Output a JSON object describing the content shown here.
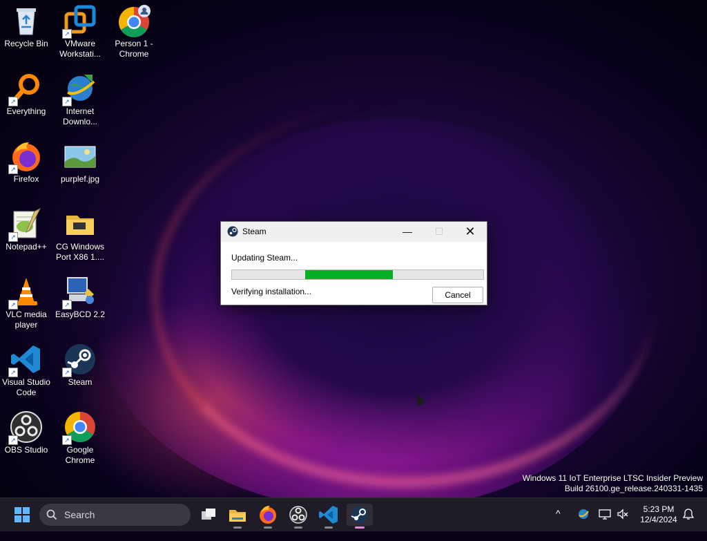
{
  "desktop": {
    "icons": [
      {
        "label": "Recycle Bin"
      },
      {
        "label": "VMware Workstati..."
      },
      {
        "label": "Person 1 - Chrome"
      },
      {
        "label": "Everything"
      },
      {
        "label": "Internet Downlo..."
      },
      {
        "label": "Firefox"
      },
      {
        "label": "purplef.jpg"
      },
      {
        "label": "Notepad++"
      },
      {
        "label": "CG Windows Port X86 1...."
      },
      {
        "label": "VLC media player"
      },
      {
        "label": "EasyBCD 2.2"
      },
      {
        "label": "Visual Studio Code"
      },
      {
        "label": "Steam"
      },
      {
        "label": "OBS Studio"
      },
      {
        "label": "Google Chrome"
      }
    ],
    "watermark": {
      "line1": "Windows 11 IoT Enterprise LTSC Insider Preview",
      "line2": "Build 26100.ge_release.240331-1435"
    }
  },
  "dialog": {
    "title": "Steam",
    "status": "Updating Steam...",
    "detail": "Verifying installation...",
    "cancel_label": "Cancel",
    "progress": 0.35,
    "minimize_glyph": "—",
    "maximize_glyph": "☐",
    "close_glyph": "✕"
  },
  "taskbar": {
    "search_label": "Search",
    "clock_time": "5:23 PM",
    "clock_date": "12/4/2024",
    "chevron_glyph": "^"
  },
  "colors": {
    "progress_fill": "#06b025",
    "taskbar_bg": "#1f1c27"
  }
}
